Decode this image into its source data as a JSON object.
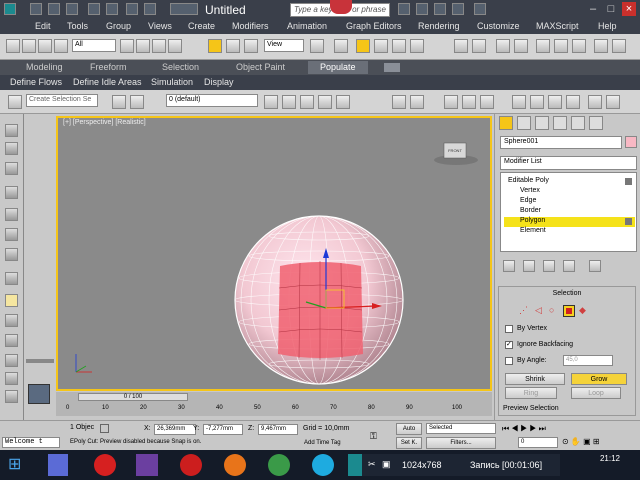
{
  "window": {
    "title": "Untitled",
    "search_placeholder": "Type a keyword or phrase",
    "minimize": "–",
    "maximize": "□",
    "close": "×"
  },
  "menubar": [
    "Edit",
    "Tools",
    "Group",
    "Views",
    "Create",
    "Modifiers",
    "Animation",
    "Graph Editors",
    "Rendering",
    "Customize",
    "MAXScript",
    "Help"
  ],
  "main_toolbar": {
    "selection_filter": "All",
    "reference_coord": "View"
  },
  "ribbon_tabs": [
    "Modeling",
    "Freeform",
    "Selection",
    "Object Paint",
    "Populate"
  ],
  "ribbon_active": "Populate",
  "ribbon_subtabs": [
    "Define Flows",
    "Define Idle Areas",
    "Simulation",
    "Display"
  ],
  "second_toolbar": {
    "selection_set_placeholder": "Create Selection Se",
    "layer": "0 (default)"
  },
  "viewport": {
    "label": "[+] [Perspective] [Realistic]",
    "viewcube_label": "FRONT"
  },
  "command_panel": {
    "object_name": "Sphere001",
    "object_color": "#f8b8c4",
    "modifier_list": "Modifier List",
    "stack": [
      "Editable Poly",
      "Vertex",
      "Edge",
      "Border",
      "Polygon",
      "Element"
    ],
    "stack_selected": "Polygon",
    "rollout_title": "Selection",
    "by_vertex": "By Vertex",
    "ignore_backfacing": "Ignore Backfacing",
    "by_angle": "By Angle:",
    "angle_value": "45,0",
    "shrink": "Shrink",
    "grow": "Grow",
    "ring": "Ring",
    "loop": "Loop",
    "preview_selection": "Preview Selection"
  },
  "timeline": {
    "slider": "0 / 100",
    "ticks": [
      "0",
      "10",
      "20",
      "30",
      "40",
      "50",
      "60",
      "70",
      "80",
      "90",
      "100"
    ]
  },
  "statusbar": {
    "objects_selected": "1 Objec",
    "x_label": "X:",
    "x_value": "26,369mm",
    "y_label": "Y:",
    "y_value": "-7,277mm",
    "z_label": "Z:",
    "z_value": "9,467mm",
    "grid": "Grid = 10,0mm",
    "prompt": "EPoly Cut: Preview disabled because Snap is on.",
    "add_time_tag": "Add Time Tag",
    "auto": "Auto",
    "set_key": "Set K.",
    "selected": "Selected",
    "filters": "Filters...",
    "frame": "0",
    "maxscript": "Welcome t"
  },
  "taskbar": {
    "recording_resolution": "1024x768",
    "recording_label": "Запись [00:01:06]",
    "time": "21:12"
  }
}
